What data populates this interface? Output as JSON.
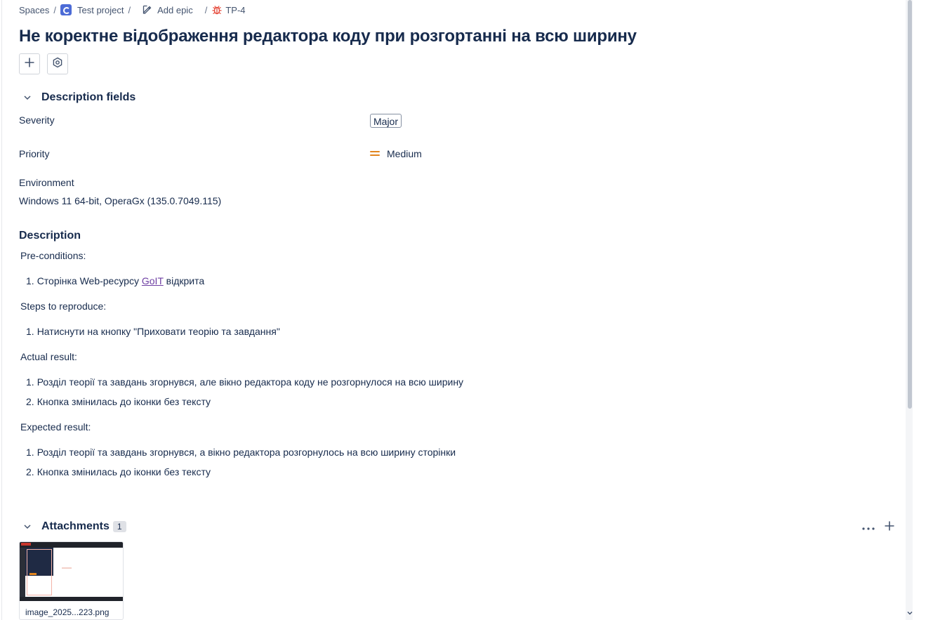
{
  "breadcrumb": {
    "spaces": "Spaces",
    "project": "Test project",
    "epic": "Add epic",
    "issue_key": "TP-4",
    "separator": "/"
  },
  "issue": {
    "title": "Не коректне відображення редактора коду при розгортанні на всю ширину"
  },
  "actions": {
    "add_icon": "plus-icon",
    "apps_icon": "hexagon-gear-icon"
  },
  "description_fields": {
    "heading": "Description fields",
    "severity_label": "Severity",
    "severity_value": "Major",
    "priority_label": "Priority",
    "priority_value": "Medium",
    "priority_color": "#e2851e",
    "environment_label": "Environment",
    "environment_value": "Windows 11 64-bit, OperaGx (135.0.7049.115)"
  },
  "description": {
    "heading": "Description",
    "preconditions_label": "Pre-conditions:",
    "preconditions": [
      {
        "num": "1.",
        "before": "Сторінка Web-ресурсу ",
        "link": "GoIT",
        "after": " відкрита"
      }
    ],
    "steps_label": "Steps to reproduce:",
    "steps": [
      {
        "num": "1.",
        "text": "Натиснути на кнопку \"Приховати теорію та завдання\""
      }
    ],
    "actual_label": "Actual result:",
    "actual": [
      {
        "num": "1.",
        "text": "Розділ теорії та завдань згорнувся, але вікно редактора коду не розгорнулося на всю ширину"
      },
      {
        "num": "2.",
        "text": "Кнопка змінилась до іконки без тексту"
      }
    ],
    "expected_label": "Expected result:",
    "expected": [
      {
        "num": "1.",
        "text": "Розділ теорії та завдань згорнувся, а вікно редактора розгорнулось на всю ширину сторінки"
      },
      {
        "num": "2.",
        "text": "Кнопка змінилась до іконки без тексту"
      }
    ]
  },
  "attachments": {
    "heading": "Attachments",
    "count": "1",
    "items": [
      {
        "name": "image_2025...223.png"
      }
    ]
  },
  "colors": {
    "text": "#172b4d",
    "link": "#6e3fa3",
    "bug": "#e5493a",
    "project": "#4c6bd6"
  }
}
